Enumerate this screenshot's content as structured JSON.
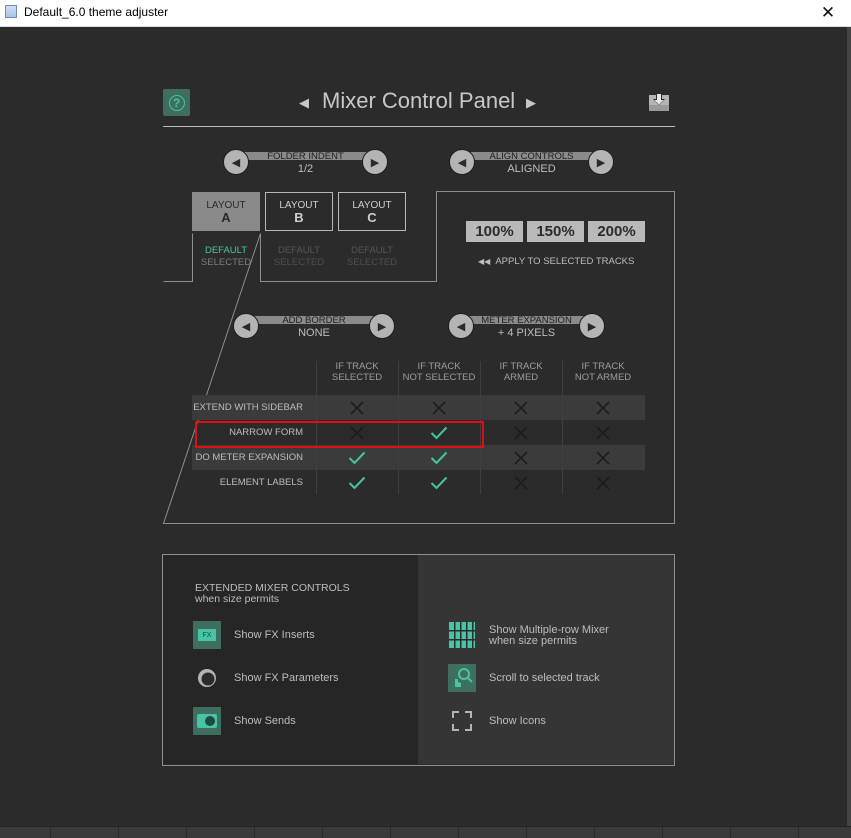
{
  "window": {
    "title": "Default_6.0 theme adjuster",
    "close_glyph": "✕"
  },
  "header": {
    "help_glyph": "?",
    "title": "Mixer Control Panel",
    "prev_icon": "triangle-left",
    "next_icon": "triangle-right",
    "save_icon": "download-icon"
  },
  "spinners": {
    "folder_indent": {
      "label": "FOLDER INDENT",
      "value": "1/2"
    },
    "align_controls": {
      "label": "ALIGN CONTROLS",
      "value": "ALIGNED"
    },
    "add_border": {
      "label": "ADD BORDER",
      "value": "NONE"
    },
    "meter_expansion": {
      "label": "METER EXPANSION",
      "value": "+ 4 PIXELS"
    }
  },
  "layouts": [
    {
      "top": "LAYOUT",
      "letter": "A",
      "sub1": "DEFAULT",
      "sub2": "SELECTED",
      "active": true
    },
    {
      "top": "LAYOUT",
      "letter": "B",
      "sub1": "DEFAULT",
      "sub2": "SELECTED",
      "active": false
    },
    {
      "top": "LAYOUT",
      "letter": "C",
      "sub1": "DEFAULT",
      "sub2": "SELECTED",
      "active": false
    }
  ],
  "scale": {
    "buttons": [
      "100%",
      "150%",
      "200%"
    ],
    "apply_label": "APPLY TO SELECTED TRACKS",
    "apply_icon": "◀◀"
  },
  "matrix": {
    "columns": [
      {
        "line1": "IF TRACK",
        "line2": "SELECTED"
      },
      {
        "line1": "IF TRACK",
        "line2": "NOT SELECTED"
      },
      {
        "line1": "IF TRACK",
        "line2": "ARMED"
      },
      {
        "line1": "IF TRACK",
        "line2": "NOT ARMED"
      }
    ],
    "rows": [
      {
        "label": "EXTEND WITH SIDEBAR",
        "cells": [
          "off",
          "off",
          "off",
          "off"
        ]
      },
      {
        "label": "NARROW FORM",
        "cells": [
          "off",
          "on",
          "off",
          "off"
        ]
      },
      {
        "label": "DO METER EXPANSION",
        "cells": [
          "on",
          "on",
          "off",
          "off"
        ]
      },
      {
        "label": "ELEMENT LABELS",
        "cells": [
          "on",
          "on",
          "off",
          "off"
        ]
      }
    ]
  },
  "extended": {
    "title": "EXTENDED MIXER CONTROLS",
    "subtitle": "when size permits",
    "left": [
      {
        "label": "Show FX Inserts",
        "icon": "fx-inserts-icon",
        "icon_text": "FX"
      },
      {
        "label": "Show FX Parameters",
        "icon": "fx-parameters-icon"
      },
      {
        "label": "Show Sends",
        "icon": "sends-icon"
      }
    ],
    "right": [
      {
        "label": "Show Multiple-row Mixer",
        "label2": "when size permits",
        "icon": "multirow-mixer-icon"
      },
      {
        "label": "Scroll to selected track",
        "icon": "scroll-to-track-icon"
      },
      {
        "label": "Show Icons",
        "icon": "show-icons-icon"
      }
    ]
  },
  "colors": {
    "accent": "#45c5a4",
    "background": "#2b2b2b",
    "highlight": "#e01010"
  }
}
